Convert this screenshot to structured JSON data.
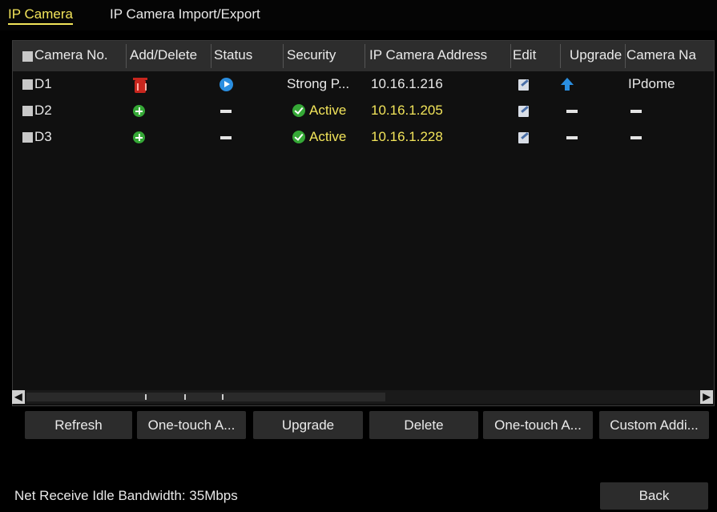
{
  "tabs": [
    {
      "label": "IP Camera",
      "active": true
    },
    {
      "label": "IP Camera Import/Export",
      "active": false
    }
  ],
  "table": {
    "columns": [
      "Camera No.",
      "Add/Delete",
      "Status",
      "Security",
      "IP Camera Address",
      "Edit",
      "Upgrade",
      "Camera Na"
    ],
    "rows": [
      {
        "camera_no": "D1",
        "add_delete_icon": "delete-icon",
        "status_icon": "play-icon",
        "security": "Strong P...",
        "ip": "10.16.1.216",
        "edit_icon": "edit-icon",
        "upgrade_icon": "upgrade-arrow-icon",
        "camera_name": "IPdome"
      },
      {
        "camera_no": "D2",
        "add_delete_icon": "add-icon",
        "status": "—",
        "security_icon": "check-icon",
        "security": "Active",
        "ip": "10.16.1.205",
        "edit_icon": "edit-icon",
        "upgrade": "—",
        "camera_name": "—"
      },
      {
        "camera_no": "D3",
        "add_delete_icon": "add-icon",
        "status": "—",
        "security_icon": "check-icon",
        "security": "Active",
        "ip": "10.16.1.228",
        "edit_icon": "edit-icon",
        "upgrade": "—",
        "camera_name": "—"
      }
    ]
  },
  "buttons": {
    "refresh": "Refresh",
    "one_touch_1": "One-touch A...",
    "upgrade": "Upgrade",
    "delete": "Delete",
    "one_touch_2": "One-touch A...",
    "custom_adding": "Custom Addi...",
    "back": "Back"
  },
  "status": {
    "bandwidth": "Net Receive Idle Bandwidth: 35Mbps"
  },
  "colors": {
    "accent_yellow": "#f2e45a",
    "delete_red": "#c8261e",
    "add_green": "#35a836",
    "status_blue": "#2a8ee0"
  }
}
